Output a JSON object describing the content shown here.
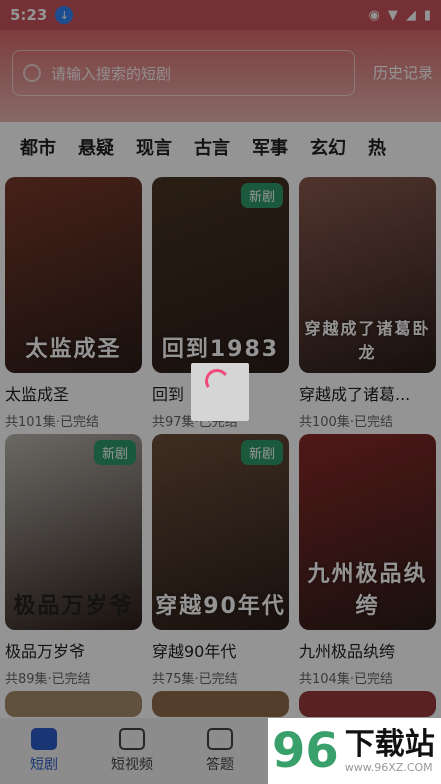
{
  "status": {
    "time": "5:23"
  },
  "search": {
    "placeholder": "请输入搜索的短剧",
    "history_label": "历史记录"
  },
  "categories": [
    "都市",
    "悬疑",
    "现言",
    "古言",
    "军事",
    "玄幻",
    "热"
  ],
  "cards": [
    {
      "title": "太监成圣",
      "meta": "共101集·已完结",
      "badge": "",
      "art": "太监成圣",
      "color": "#7a3a2c"
    },
    {
      "title": "回到",
      "meta": "共97集·已完结",
      "badge": "新剧",
      "art": "回到1983",
      "color": "#4a3524"
    },
    {
      "title": "穿越成了诸葛...",
      "meta": "共100集·已完结",
      "badge": "",
      "art": "穿越成了诸葛卧龙",
      "color": "#8a5a50"
    },
    {
      "title": "极品万岁爷",
      "meta": "共89集·已完结",
      "badge": "新剧",
      "art": "极品万岁爷",
      "color": "#b9b5ae"
    },
    {
      "title": "穿越90年代",
      "meta": "共75集·已完结",
      "badge": "新剧",
      "art": "穿越90年代",
      "color": "#6b4f3a"
    },
    {
      "title": "九州极品纨绔",
      "meta": "共104集·已完结",
      "badge": "",
      "art": "九州极品纨绔",
      "color": "#8b2a2a"
    }
  ],
  "tabs": [
    {
      "label": "短剧",
      "active": true
    },
    {
      "label": "短视频",
      "active": false
    },
    {
      "label": "答题",
      "active": false
    }
  ],
  "watermark": {
    "number": "96",
    "text": "下载站",
    "url": "www.96XZ.COM"
  }
}
